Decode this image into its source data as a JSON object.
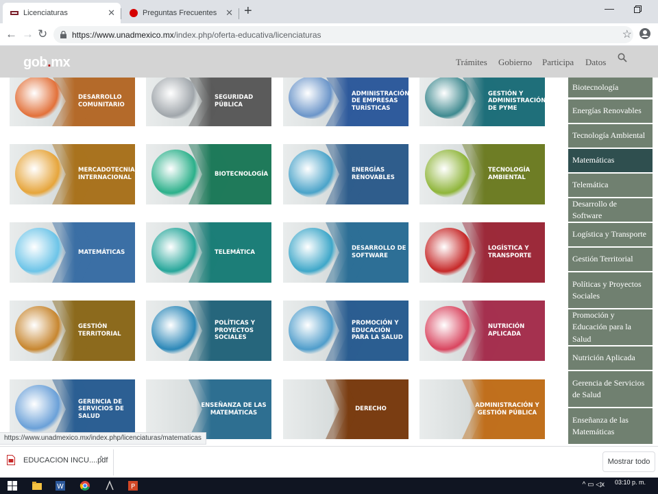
{
  "browser": {
    "tabs": [
      {
        "title": "Licenciaturas",
        "active": true
      },
      {
        "title": "Preguntas Frecuentes",
        "active": false
      }
    ],
    "url_domain": "https://www.unadmexico.mx",
    "url_path": "/index.php/oferta-educativa/licenciaturas",
    "status_link": "https://www.unadmexico.mx/index.php/licenciaturas/matematicas"
  },
  "gov_header": {
    "logo_main": "gob",
    "logo_dot": ".",
    "logo_tld": "mx",
    "nav": [
      "Trámites",
      "Gobierno",
      "Participa",
      "Datos"
    ]
  },
  "cards": [
    {
      "label": "Desarrollo Comunitario",
      "color": "#b46a2a",
      "icon_color": "#e2713a"
    },
    {
      "label": "Seguridad Pública",
      "color": "#5b5b5b",
      "icon_color": "#a0a6ab"
    },
    {
      "label": "Administración de Empresas Turísticas",
      "color": "#2f5b9c",
      "icon_color": "#6b95c9"
    },
    {
      "label": "Gestión y Administración de PyME",
      "color": "#1f6f7a",
      "icon_color": "#3f8a90"
    },
    {
      "label": "Mercadotecnia Internacional",
      "color": "#a9731f",
      "icon_color": "#e6a53b"
    },
    {
      "label": "Biotecnología",
      "color": "#1f7a5a",
      "icon_color": "#2bb08a"
    },
    {
      "label": "Energías Renovables",
      "color": "#2f5d8c",
      "icon_color": "#4aa3c9"
    },
    {
      "label": "Tecnología Ambiental",
      "color": "#6e7d25",
      "icon_color": "#8fb53a"
    },
    {
      "label": "Matemáticas",
      "color": "#3b6fa5",
      "icon_color": "#6cc4e8"
    },
    {
      "label": "Telemática",
      "color": "#1c7e78",
      "icon_color": "#26a69a"
    },
    {
      "label": "Desarrollo de Software",
      "color": "#2d6f96",
      "icon_color": "#3ea7c9"
    },
    {
      "label": "Logística y Transporte",
      "color": "#9c2a3a",
      "icon_color": "#c62828"
    },
    {
      "label": "Gestión Territorial",
      "color": "#8c6a1d",
      "icon_color": "#c7862f"
    },
    {
      "label": "Políticas y Proyectos Sociales",
      "color": "#26667c",
      "icon_color": "#2c88b8"
    },
    {
      "label": "Promoción y Educación para la Salud",
      "color": "#2b5e91",
      "icon_color": "#4f9dcb"
    },
    {
      "label": "Nutrición Aplicada",
      "color": "#a5314f",
      "icon_color": "#d9455f"
    },
    {
      "label": "Gerencia de Servicios de Salud",
      "color": "#2c5f93",
      "icon_color": "#6aa0d8"
    },
    {
      "label": "Enseñanza de las Matemáticas",
      "color": "#2e6f91",
      "icon_color": ""
    },
    {
      "label": "Derecho",
      "color": "#7a3d12",
      "icon_color": ""
    },
    {
      "label": "Administración y Gestión Pública",
      "color": "#c0701d",
      "icon_color": ""
    }
  ],
  "sidebar": {
    "items": [
      {
        "label": "Biotecnología",
        "active": false
      },
      {
        "label": "Energías Renovables",
        "active": false
      },
      {
        "label": "Tecnología Ambiental",
        "active": false
      },
      {
        "label": "Matemáticas",
        "active": true
      },
      {
        "label": "Telemática",
        "active": false
      },
      {
        "label": "Desarrollo de Software",
        "active": false
      },
      {
        "label": "Logística y Transporte",
        "active": false
      },
      {
        "label": "Gestión Territorial",
        "active": false
      },
      {
        "label": "Políticas y Proyectos Sociales",
        "active": false
      },
      {
        "label": "Promoción y Educación para la Salud",
        "active": false
      },
      {
        "label": "Nutrición Aplicada",
        "active": false
      },
      {
        "label": "Gerencia de Servicios de Salud",
        "active": false
      },
      {
        "label": "Enseñanza de las Matemáticas",
        "active": false
      }
    ]
  },
  "downloads": {
    "file_name": "EDUCACION INCU....pdf",
    "show_all_label": "Mostrar todo"
  },
  "taskbar": {
    "clock_time": "03:10 p. m."
  }
}
